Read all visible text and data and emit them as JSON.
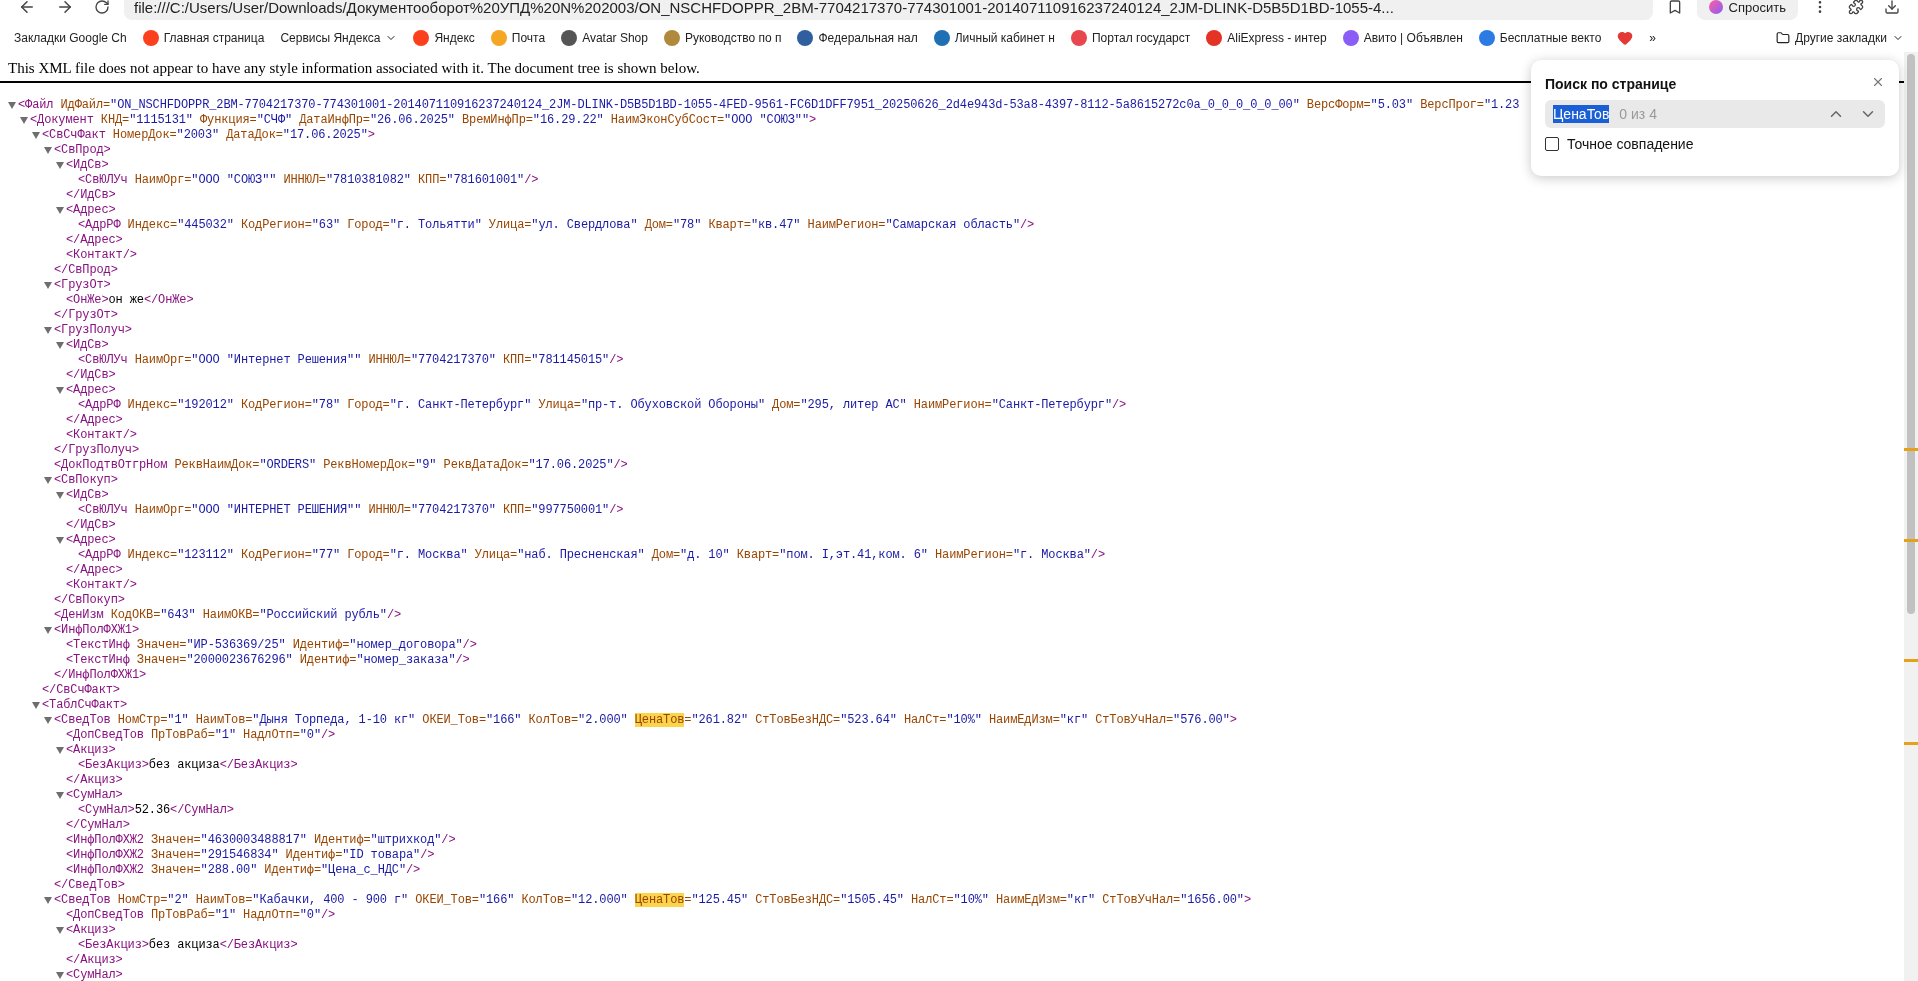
{
  "browser": {
    "address": "file:///C:/Users/User/Downloads/Документооборот%20УПД%20N%202003/ON_NSCHFDOPPR_2BM-7704217370-774301001-201407110916237240124_2JM-DLINK-D5B5D1BD-1055-4...",
    "ask_button": "Спросить"
  },
  "bookmarks": {
    "items": [
      {
        "label": "Закладки Google Ch",
        "dropdown": false
      },
      {
        "label": "Главная страница",
        "dropdown": false,
        "color": "#fc3f1d"
      },
      {
        "label": "Сервисы Яндекса",
        "dropdown": true
      },
      {
        "label": "Яндекс",
        "dropdown": false,
        "color": "#fc3f1d"
      },
      {
        "label": "Почта",
        "dropdown": false,
        "color": "#f5a623"
      },
      {
        "label": "Avatar Shop",
        "dropdown": false,
        "color": "#555555"
      },
      {
        "label": "Руководство по п",
        "dropdown": false,
        "color": "#b08a3c"
      },
      {
        "label": "Федеральная нал",
        "dropdown": false,
        "color": "#2f5f9e"
      },
      {
        "label": "Личный кабинет н",
        "dropdown": false,
        "color": "#1f6fb5"
      },
      {
        "label": "Портал государст",
        "dropdown": false,
        "color": "#e8474d"
      },
      {
        "label": "AliExpress - интер",
        "dropdown": false,
        "color": "#e43225"
      },
      {
        "label": "Авито | Объявлен",
        "dropdown": false,
        "color": "#8b5cf6"
      },
      {
        "label": "Бесплатные векто",
        "dropdown": false,
        "color": "#2c7be5"
      }
    ],
    "more": "»",
    "other": "Другие закладки"
  },
  "notice": "This XML file does not appear to have any style information associated with it. The document tree is shown below.",
  "xml_tree": [
    {
      "open": "<Файл ИдФайл=\"ON_NSCHFDOPPR_2BM-7704217370-774301001-201407110916237240124_2JM-DLINK-D5B5D1BD-1055-4FED-9561-FC6D1DFF7951_20250626_2d4e943d-53a8-4397-8112-5a8615272c0a_0_0_0_0_0_00\" ВерсФорм=\"5.03\" ВерсПрог=\"1.23",
      "expanded": true,
      "children": [
        {
          "open": "<Документ КНД=\"1115131\" Функция=\"СЧФ\" ДатаИнфПр=\"26.06.2025\" ВремИнфПр=\"16.29.22\" НаимЭконСубСост=\"ООО \"СОЮЗ\"\">",
          "expanded": true,
          "children": [
            {
              "open": "<СвСчФакт НомерДок=\"2003\" ДатаДок=\"17.06.2025\">",
              "expanded": true,
              "close": "</СвСчФакт>",
              "children": [
                {
                  "open": "<СвПрод>",
                  "expanded": true,
                  "close": "</СвПрод>",
                  "children": [
                    {
                      "open": "<ИдСв>",
                      "expanded": true,
                      "close": "</ИдСв>",
                      "children": [
                        {
                          "open": "<СвЮЛУч НаимОрг=\"ООО \"СОЮЗ\"\" ИННЮЛ=\"7810381082\" КПП=\"781601001\"/>"
                        }
                      ]
                    },
                    {
                      "open": "<Адрес>",
                      "expanded": true,
                      "close": "</Адрес>",
                      "children": [
                        {
                          "open": "<АдрРФ Индекс=\"445032\" КодРегион=\"63\" Город=\"г. Тольятти\" Улица=\"ул. Свердлова\" Дом=\"78\" Кварт=\"кв.47\" НаимРегион=\"Самарская область\"/>"
                        }
                      ]
                    },
                    {
                      "open": "<Контакт/>"
                    }
                  ]
                },
                {
                  "open": "<ГрузОт>",
                  "expanded": true,
                  "close": "</ГрузОт>",
                  "children": [
                    {
                      "open": "<ОнЖе>он же</ОнЖе>"
                    }
                  ]
                },
                {
                  "open": "<ГрузПолуч>",
                  "expanded": true,
                  "close": "</ГрузПолуч>",
                  "children": [
                    {
                      "open": "<ИдСв>",
                      "expanded": true,
                      "close": "</ИдСв>",
                      "children": [
                        {
                          "open": "<СвЮЛУч НаимОрг=\"ООО \"Интернет Решения\"\" ИННЮЛ=\"7704217370\" КПП=\"781145015\"/>"
                        }
                      ]
                    },
                    {
                      "open": "<Адрес>",
                      "expanded": true,
                      "close": "</Адрес>",
                      "children": [
                        {
                          "open": "<АдрРФ Индекс=\"192012\" КодРегион=\"78\" Город=\"г. Санкт-Петербург\" Улица=\"пр-т. Обуховской Обороны\" Дом=\"295, литер АС\" НаимРегион=\"Санкт-Петербург\"/>"
                        }
                      ]
                    },
                    {
                      "open": "<Контакт/>"
                    }
                  ]
                },
                {
                  "open": "<ДокПодтвОтгрНом РеквНаимДок=\"ORDERS\" РеквНомерДок=\"9\" РеквДатаДок=\"17.06.2025\"/>"
                },
                {
                  "open": "<СвПокуп>",
                  "expanded": true,
                  "close": "</СвПокуп>",
                  "children": [
                    {
                      "open": "<ИдСв>",
                      "expanded": true,
                      "close": "</ИдСв>",
                      "children": [
                        {
                          "open": "<СвЮЛУч НаимОрг=\"ООО \"ИНТЕРНЕТ РЕШЕНИЯ\"\" ИННЮЛ=\"7704217370\" КПП=\"997750001\"/>"
                        }
                      ]
                    },
                    {
                      "open": "<Адрес>",
                      "expanded": true,
                      "close": "</Адрес>",
                      "children": [
                        {
                          "open": "<АдрРФ Индекс=\"123112\" КодРегион=\"77\" Город=\"г. Москва\" Улица=\"наб. Пресненская\" Дом=\"д. 10\" Кварт=\"пом. I,эт.41,ком. 6\" НаимРегион=\"г. Москва\"/>"
                        }
                      ]
                    },
                    {
                      "open": "<Контакт/>"
                    }
                  ]
                },
                {
                  "open": "<ДенИзм КодОКВ=\"643\" НаимОКВ=\"Российский рубль\"/>"
                },
                {
                  "open": "<ИнфПолФХЖ1>",
                  "expanded": true,
                  "close": "</ИнфПолФХЖ1>",
                  "children": [
                    {
                      "open": "<ТекстИнф Значен=\"ИР-536369/25\" Идентиф=\"номер_договора\"/>"
                    },
                    {
                      "open": "<ТекстИнф Значен=\"2000023676296\" Идентиф=\"номер_заказа\"/>"
                    }
                  ]
                }
              ]
            },
            {
              "open": "<ТаблСчФакт>",
              "expanded": true,
              "children": [
                {
                  "open_parts": [
                    {
                      "text": "<СведТов НомСтр=\"1\" НаимТов=\"Дыня Торпеда, 1-10 кг\" ОКЕИ_Тов=\"166\" КолТов=\"2.000\" ",
                      "highlighted": false
                    },
                    {
                      "text": "ЦенаТов",
                      "highlighted": true
                    },
                    {
                      "text": "=\"261.82\" СтТовБезНДС=\"523.64\" НалСт=\"10%\" НаимЕдИзм=\"кг\" СтТовУчНал=\"576.00\">",
                      "highlighted": false
                    }
                  ],
                  "expanded": true,
                  "close": "</СведТов>",
                  "children": [
                    {
                      "open": "<ДопСведТов ПрТовРаб=\"1\" НадлОтп=\"0\"/>"
                    },
                    {
                      "open": "<Акциз>",
                      "expanded": true,
                      "close": "</Акциз>",
                      "children": [
                        {
                          "open": "<БезАкциз>без акциза</БезАкциз>"
                        }
                      ]
                    },
                    {
                      "open": "<СумНал>",
                      "expanded": true,
                      "close": "</СумНал>",
                      "children": [
                        {
                          "open": "<СумНал>52.36</СумНал>"
                        }
                      ]
                    },
                    {
                      "open": "<ИнфПолФХЖ2 Значен=\"4630003488817\" Идентиф=\"штрихкод\"/>"
                    },
                    {
                      "open": "<ИнфПолФХЖ2 Значен=\"291546834\" Идентиф=\"ID товара\"/>"
                    },
                    {
                      "open": "<ИнфПолФХЖ2 Значен=\"288.00\" Идентиф=\"Цена_с_НДС\"/>"
                    }
                  ]
                },
                {
                  "open_parts": [
                    {
                      "text": "<СведТов НомСтр=\"2\" НаимТов=\"Кабачки, 400 - 900 г\" ОКЕИ_Тов=\"166\" КолТов=\"12.000\" ",
                      "highlighted": false
                    },
                    {
                      "text": "ЦенаТов",
                      "highlighted": true
                    },
                    {
                      "text": "=\"125.45\" СтТовБезНДС=\"1505.45\" НалСт=\"10%\" НаимЕдИзм=\"кг\" СтТовУчНал=\"1656.00\">",
                      "highlighted": false
                    }
                  ],
                  "expanded": true,
                  "children": [
                    {
                      "open": "<ДопСведТов ПрТовРаб=\"1\" НадлОтп=\"0\"/>"
                    },
                    {
                      "open": "<Акциз>",
                      "expanded": true,
                      "close": "</Акциз>",
                      "children": [
                        {
                          "open": "<БезАкциз>без акциза</БезАкциз>"
                        }
                      ]
                    },
                    {
                      "open": "<СумНал>",
                      "expanded": true
                    }
                  ]
                }
              ]
            }
          ]
        }
      ]
    }
  ],
  "find_bar": {
    "title": "Поиск по странице",
    "query": "ЦенаТов",
    "count": "0 из 4",
    "exact_match": {
      "label": "Точное совпадение",
      "checked": false
    }
  }
}
